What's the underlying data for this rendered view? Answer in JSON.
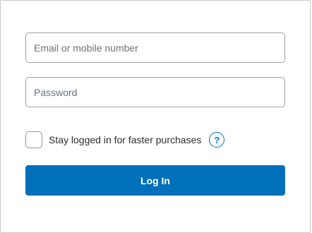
{
  "login_form": {
    "email_placeholder": "Email or mobile number",
    "email_value": "",
    "password_placeholder": "Password",
    "password_value": "",
    "stay_logged_in_label": "Stay logged in for faster purchases",
    "stay_logged_in_checked": false,
    "help_icon": "question-mark-circle-icon",
    "help_glyph": "?",
    "login_button_label": "Log In"
  },
  "colors": {
    "accent": "#0070ba",
    "border": "#9ea3a7",
    "text": "#2c2e2f",
    "placeholder": "#6c7378"
  }
}
